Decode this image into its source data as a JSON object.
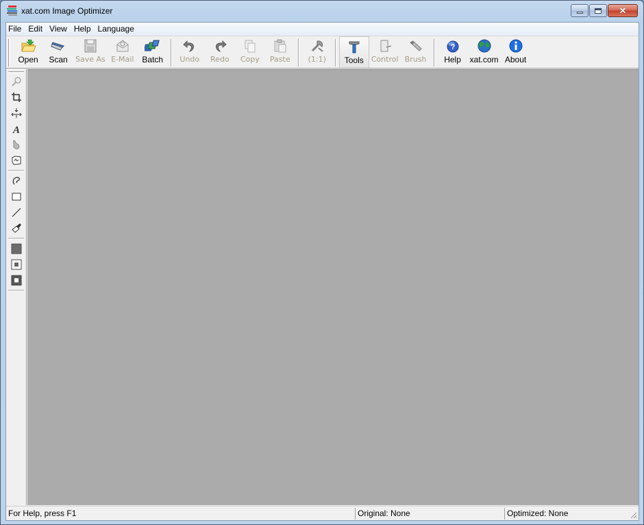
{
  "window": {
    "title": "xat.com Image Optimizer",
    "icons": {
      "app": "xat-optimizer-app-icon"
    },
    "caption_buttons": [
      {
        "name": "minimize",
        "icon": "minimize-icon"
      },
      {
        "name": "maximize",
        "icon": "maximize-icon"
      },
      {
        "name": "close",
        "icon": "close-icon",
        "glyph": "✕"
      }
    ]
  },
  "menubar": {
    "items": [
      {
        "label": "File"
      },
      {
        "label": "Edit"
      },
      {
        "label": "View"
      },
      {
        "label": "Help"
      },
      {
        "label": "Language"
      }
    ]
  },
  "toolbar": {
    "buttons": [
      {
        "label": "Open",
        "icon": "folder-open-icon",
        "enabled": true
      },
      {
        "label": "Scan",
        "icon": "scanner-icon",
        "enabled": true
      },
      {
        "label": "Save As",
        "icon": "floppy-disk-icon",
        "enabled": false
      },
      {
        "label": "E-Mail",
        "icon": "email-icon",
        "enabled": false
      },
      {
        "label": "Batch",
        "icon": "batch-icon",
        "enabled": true
      },
      {
        "label": "Undo",
        "icon": "undo-icon",
        "enabled": false
      },
      {
        "label": "Redo",
        "icon": "redo-icon",
        "enabled": false
      },
      {
        "label": "Copy",
        "icon": "copy-icon",
        "enabled": false
      },
      {
        "label": "Paste",
        "icon": "paste-icon",
        "enabled": false
      },
      {
        "label": "(1:1)",
        "icon": "actual-size-icon",
        "enabled": false
      },
      {
        "label": "Tools",
        "icon": "hammer-icon",
        "enabled": true,
        "active": true
      },
      {
        "label": "Control",
        "icon": "control-icon",
        "enabled": false
      },
      {
        "label": "Brush",
        "icon": "brush-icon",
        "enabled": false
      },
      {
        "label": "Help",
        "icon": "help-icon",
        "enabled": true
      },
      {
        "label": "xat.com",
        "icon": "globe-icon",
        "enabled": true
      },
      {
        "label": "About",
        "icon": "info-icon",
        "enabled": true
      }
    ]
  },
  "side_toolbar": {
    "tools": [
      {
        "name": "zoom",
        "icon": "magnifier-icon"
      },
      {
        "name": "crop",
        "icon": "crop-icon"
      },
      {
        "name": "resize",
        "icon": "resize-icon"
      },
      {
        "name": "text",
        "icon": "text-icon"
      },
      {
        "name": "effects",
        "icon": "effects-icon"
      },
      {
        "name": "stamp",
        "icon": "stamp-icon"
      },
      {
        "name": "lasso",
        "icon": "lasso-icon"
      },
      {
        "name": "rectangle",
        "icon": "rectangle-icon"
      },
      {
        "name": "line",
        "icon": "line-icon"
      },
      {
        "name": "fill",
        "icon": "paint-bucket-icon"
      },
      {
        "name": "solid-color",
        "icon": "solid-color-icon"
      },
      {
        "name": "pattern-light",
        "icon": "pattern-light-icon"
      },
      {
        "name": "pattern-dark",
        "icon": "pattern-dark-icon"
      }
    ]
  },
  "statusbar": {
    "help": "For Help, press F1",
    "original": "Original: None",
    "optimized": "Optimized: None"
  },
  "colors": {
    "canvas_background": "#ababab",
    "disabled_text": "#a49d86",
    "close_button": "#c9462f"
  }
}
